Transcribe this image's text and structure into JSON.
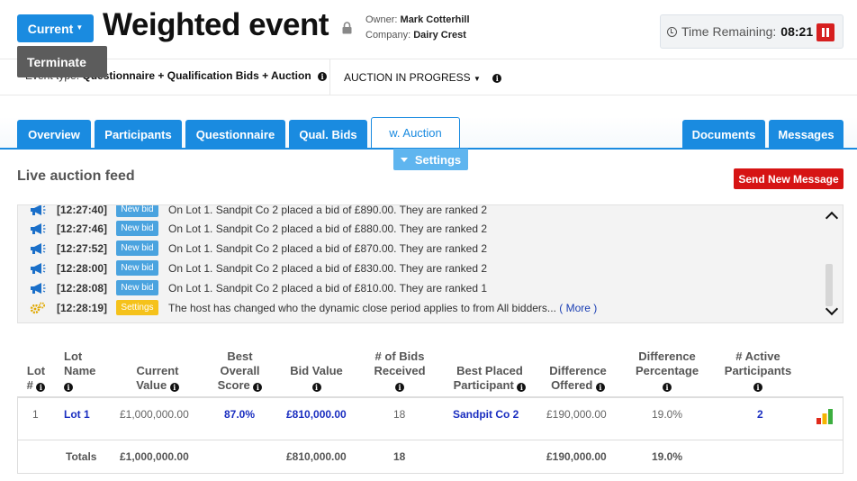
{
  "header": {
    "current_label": "Current",
    "terminate_label": "Terminate",
    "title": "Weighted event",
    "owner_label": "Owner:",
    "owner_value": "Mark Cotterhill",
    "company_label": "Company:",
    "company_value": "Dairy Crest",
    "time_label": "Time Remaining:",
    "time_value": "08:21"
  },
  "event_bar": {
    "event_type_label": "Event type:",
    "event_type": "Questionnaire + Qualification Bids + Auction",
    "status": "AUCTION IN PROGRESS"
  },
  "tabs": {
    "left": [
      "Overview",
      "Participants",
      "Questionnaire",
      "Qual. Bids",
      "w. Auction"
    ],
    "right": [
      "Documents",
      "Messages"
    ],
    "active": "w. Auction",
    "settings_label": "Settings"
  },
  "feed": {
    "title": "Live auction feed",
    "send_label": "Send New Message",
    "rows": [
      {
        "time": "[12:27:40]",
        "badge": "New bid",
        "text": "On Lot 1. Sandpit Co 2 placed a bid of £890.00. They are ranked 2",
        "more": ""
      },
      {
        "time": "[12:27:46]",
        "badge": "New bid",
        "text": "On Lot 1. Sandpit Co 2 placed a bid of £880.00. They are ranked 2",
        "more": ""
      },
      {
        "time": "[12:27:52]",
        "badge": "New bid",
        "text": "On Lot 1. Sandpit Co 2 placed a bid of £870.00. They are ranked 2",
        "more": ""
      },
      {
        "time": "[12:28:00]",
        "badge": "New bid",
        "text": "On Lot 1. Sandpit Co 2 placed a bid of £830.00. They are ranked 2",
        "more": ""
      },
      {
        "time": "[12:28:08]",
        "badge": "New bid",
        "text": "On Lot 1. Sandpit Co 2 placed a bid of £810.00. They are ranked 1",
        "more": ""
      },
      {
        "time": "[12:28:19]",
        "badge": "Settings",
        "text": "The host has changed who the dynamic close period applies to from All bidders...",
        "more": "( More )"
      }
    ]
  },
  "table": {
    "headers": [
      [
        "Lot",
        "#"
      ],
      [
        "Lot",
        "Name"
      ],
      [
        "Current",
        "Value"
      ],
      [
        "Best",
        "Overall",
        "Score"
      ],
      [
        "Bid Value"
      ],
      [
        "# of Bids",
        "Received"
      ],
      [
        "Best Placed",
        "Participant"
      ],
      [
        "Difference",
        "Offered"
      ],
      [
        "Difference",
        "Percentage"
      ],
      [
        "# Active",
        "Participants"
      ]
    ],
    "row": {
      "lot_no": "1",
      "lot_name": "Lot 1",
      "current_value": "£1,000,000.00",
      "best_score": "87.0%",
      "bid_value": "£810,000.00",
      "bids_received": "18",
      "best_participant": "Sandpit Co 2",
      "diff_offered": "£190,000.00",
      "diff_pct": "19.0%",
      "active_participants": "2"
    },
    "totals": {
      "label": "Totals",
      "current_value": "£1,000,000.00",
      "bid_value": "£810,000.00",
      "bids_received": "18",
      "diff_offered": "£190,000.00",
      "diff_pct": "19.0%"
    }
  },
  "colors": {
    "primary": "#1a8be0",
    "danger": "#d61414",
    "badge_new": "#4aa3df",
    "badge_settings": "#f5c21b",
    "link": "#1a2ec0"
  },
  "icons": [
    "lock-icon",
    "clock-icon",
    "pause-icon",
    "info-icon",
    "megaphone-icon",
    "gears-icon",
    "bar-chart-icon"
  ]
}
